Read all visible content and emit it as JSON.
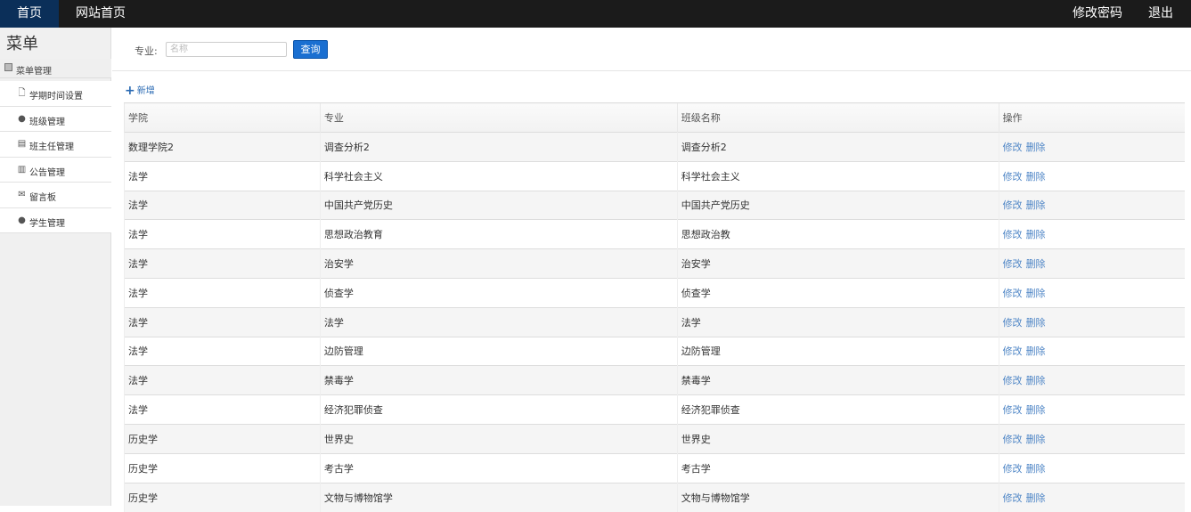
{
  "nav": {
    "home": "首页",
    "site_home": "网站首页",
    "change_password": "修改密码",
    "logout": "退出"
  },
  "sidebar": {
    "title": "菜单",
    "group": "菜单管理",
    "items": [
      {
        "label": "学期时间设置",
        "icon": "file-icon",
        "glyph": "🗋"
      },
      {
        "label": "班级管理",
        "icon": "comment-icon",
        "glyph": "●"
      },
      {
        "label": "班主任管理",
        "icon": "list-icon",
        "glyph": "▤"
      },
      {
        "label": "公告管理",
        "icon": "bars-icon",
        "glyph": "▥"
      },
      {
        "label": "留言板",
        "icon": "mail-icon",
        "glyph": "✉"
      },
      {
        "label": "学生管理",
        "icon": "comment-icon",
        "glyph": "●"
      }
    ]
  },
  "search": {
    "label": "专业:",
    "placeholder": "名称",
    "button": "查询"
  },
  "add_label": "新增",
  "table": {
    "headers": [
      "学院",
      "专业",
      "班级名称",
      "操作"
    ],
    "edit_label": "修改",
    "delete_label": "删除",
    "rows": [
      [
        "数理学院2",
        "调查分析2",
        "调查分析2"
      ],
      [
        "法学",
        "科学社会主义",
        "科学社会主义"
      ],
      [
        "法学",
        "中国共产党历史",
        "中国共产党历史"
      ],
      [
        "法学",
        "思想政治教育",
        "思想政治教"
      ],
      [
        "法学",
        "治安学",
        "治安学"
      ],
      [
        "法学",
        "侦查学",
        "侦查学"
      ],
      [
        "法学",
        "法学",
        "法学"
      ],
      [
        "法学",
        "边防管理",
        "边防管理"
      ],
      [
        "法学",
        "禁毒学",
        "禁毒学"
      ],
      [
        "法学",
        "经济犯罪侦查",
        "经济犯罪侦查"
      ],
      [
        "历史学",
        "世界史",
        "世界史"
      ],
      [
        "历史学",
        "考古学",
        "考古学"
      ],
      [
        "历史学",
        "文物与博物馆学",
        "文物与博物馆学"
      ]
    ]
  },
  "colors": {
    "topbar": "#1b1b1b",
    "active_nav": "#0b2f59",
    "primary_button": "#1a6fd1",
    "link": "#4f86c6"
  }
}
